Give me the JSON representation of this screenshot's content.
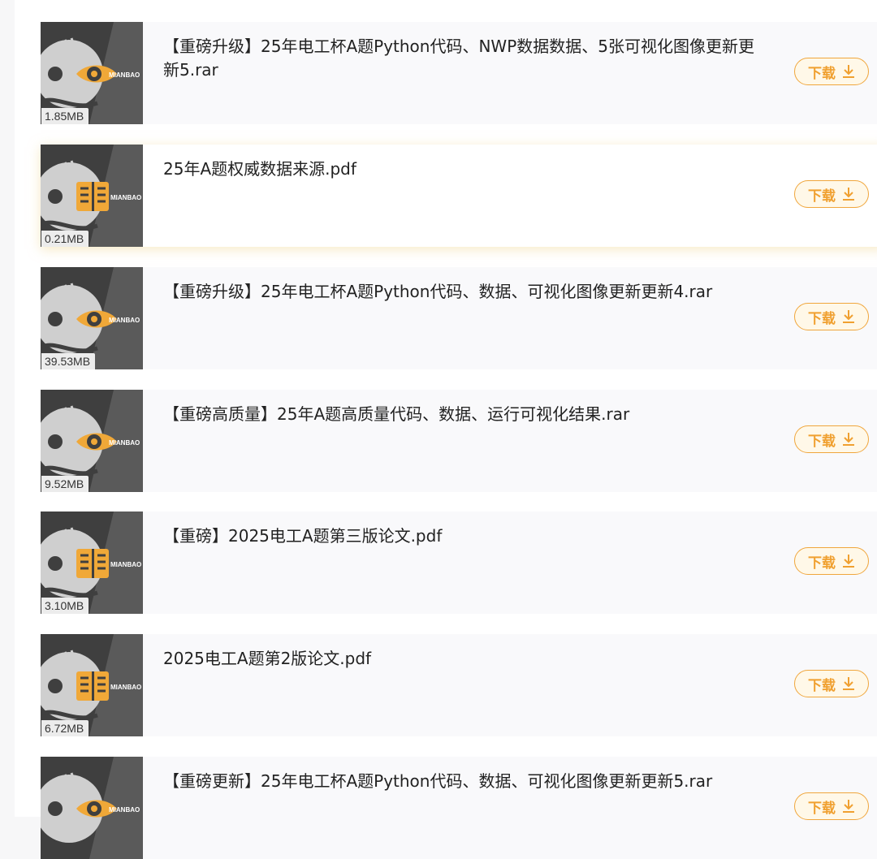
{
  "download_label": "下载",
  "files": [
    {
      "title": "【重磅升级】25年电工杯A题Python代码、NWP数据数据、5张可视化图像更新更新5.rar",
      "size": "1.85MB",
      "icon": "eye-icon"
    },
    {
      "title": "25年A题权威数据来源.pdf",
      "size": "0.21MB",
      "icon": "book-icon"
    },
    {
      "title": "【重磅升级】25年电工杯A题Python代码、数据、可视化图像更新更新4.rar",
      "size": "39.53MB",
      "icon": "eye-icon"
    },
    {
      "title": "【重磅高质量】25年A题高质量代码、数据、运行可视化结果.rar",
      "size": "9.52MB",
      "icon": "eye-icon"
    },
    {
      "title": "【重磅】2025电工A题第三版论文.pdf",
      "size": "3.10MB",
      "icon": "book-icon"
    },
    {
      "title": "2025电工A题第2版论文.pdf",
      "size": "6.72MB",
      "icon": "book-icon"
    },
    {
      "title": "【重磅更新】25年电工杯A题Python代码、数据、可视化图像更新更新5.rar",
      "size": "",
      "icon": "eye-icon"
    }
  ],
  "brand_text": "MIANBAO",
  "accent_color": "#f0a030",
  "thumb_color": "#3f3f3f"
}
